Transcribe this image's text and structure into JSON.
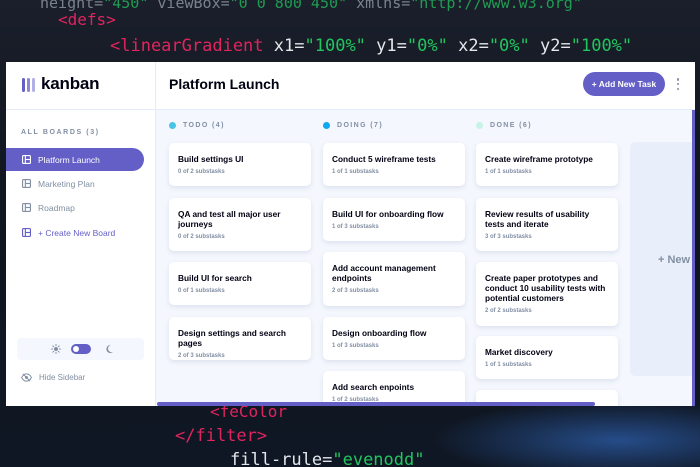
{
  "app": {
    "logo": "kanban",
    "board_title": "Platform Launch",
    "add_task": "+ Add New Task"
  },
  "sidebar": {
    "heading": "ALL BOARDS (3)",
    "items": [
      {
        "label": "Platform Launch"
      },
      {
        "label": "Marketing Plan"
      },
      {
        "label": "Roadmap"
      }
    ],
    "create": "+ Create New Board",
    "hide": "Hide Sidebar"
  },
  "columns": [
    {
      "name": "TODO (4)",
      "color": "#49c4e5",
      "cards": [
        {
          "title": "Build settings UI",
          "sub": "0 of 2 substasks"
        },
        {
          "title": "QA and test all major user journeys",
          "sub": "0 of 2 substasks"
        },
        {
          "title": "Build UI for search",
          "sub": "0 of 1 substasks"
        },
        {
          "title": "Design settings and search pages",
          "sub": "2 of 3 substasks"
        }
      ]
    },
    {
      "name": "DOING (7)",
      "color": "#0fa7f0",
      "cards": [
        {
          "title": "Conduct 5 wireframe tests",
          "sub": "1 of 1 substasks"
        },
        {
          "title": "Build UI for onboarding flow",
          "sub": "1 of 3 substasks"
        },
        {
          "title": "Add account management endpoints",
          "sub": "2 of 3 substasks"
        },
        {
          "title": "Design onboarding flow",
          "sub": "1 of 3 substasks"
        },
        {
          "title": "Add search enpoints",
          "sub": "1 of 2 substasks"
        }
      ]
    },
    {
      "name": "DONE (6)",
      "color": "#c5f3e8",
      "cards": [
        {
          "title": "Create wireframe prototype",
          "sub": "1 of 1 substasks"
        },
        {
          "title": "Review results of usability tests and iterate",
          "sub": "3 of 3 substasks"
        },
        {
          "title": "Create paper prototypes and conduct 10 usability tests with potential customers",
          "sub": "2 of 2 substasks"
        },
        {
          "title": "Market discovery",
          "sub": "1 of 1 substasks"
        }
      ]
    }
  ],
  "new_column": "+ New",
  "background_code": {
    "line1": {
      "attr1": "height=",
      "val1": "\"450\"",
      "attr2": "viewBox=",
      "val2": "\"0 0 800 450\"",
      "attr3": "xmlns=",
      "val3": "\"http://www.w3.org\""
    },
    "line2": "<defs>",
    "line3": {
      "tag": "<linearGradient",
      "attr1": "x1=",
      "val1": "\"100%\"",
      "attr2": "y1=",
      "val2": "\"0%\"",
      "attr3": "x2=",
      "val3": "\"0%\"",
      "attr4": "y2=",
      "val4": "\"100%\""
    },
    "line4": "<feColor",
    "line5": "</filter>",
    "line6": {
      "attr": "fill-rule=",
      "val": "\"evenodd\""
    }
  },
  "colors": {
    "accent": "#635fc7",
    "muted": "#828fa3",
    "text": "#000112"
  }
}
